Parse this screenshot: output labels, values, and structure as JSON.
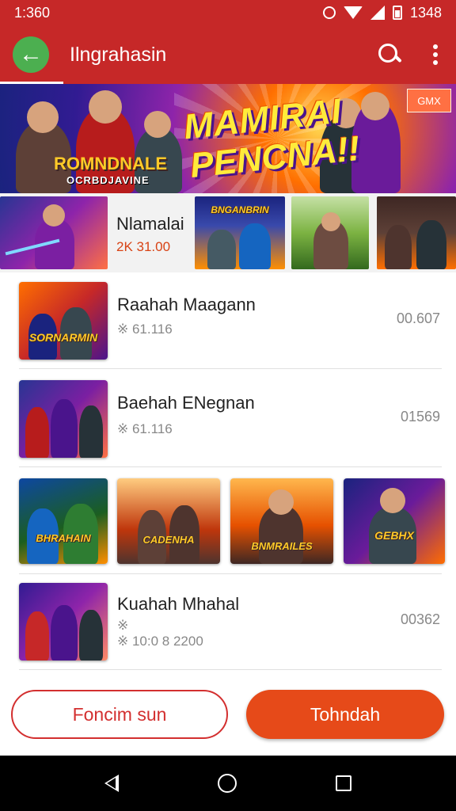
{
  "status_bar": {
    "time": "1:360",
    "right_time": "1348"
  },
  "app_bar": {
    "title": "Ilngrahasin"
  },
  "hero": {
    "headline_line1": "MAMIRAI",
    "headline_line2": "PENCNA!!",
    "logo_main": "ROMNDNALE",
    "logo_sub": "OCRBDJAVINE",
    "badge": "GMX"
  },
  "featured": {
    "title": "Nlamalai",
    "price": "2K 31.00"
  },
  "list_items": [
    {
      "title": "Raahah Maagann",
      "meta": "※ 61.116",
      "value": "00.607",
      "thumb_caption": "SORNARMIN"
    },
    {
      "title": "Baehah ENegnan",
      "meta": "※ 61.116",
      "value": "01569"
    },
    {
      "title": "Kuahah Mhahal",
      "meta": "※ 10:0 8 2200",
      "meta_top": "※",
      "value": "00362"
    }
  ],
  "grid_captions": [
    "BHRAHAIN",
    "CADENHA",
    "BNMRAILES",
    "GEBHX"
  ],
  "featured_tile_caption": "BNGANBRIN",
  "buttons": {
    "secondary": "Foncim sun",
    "primary": "Tohndah"
  }
}
